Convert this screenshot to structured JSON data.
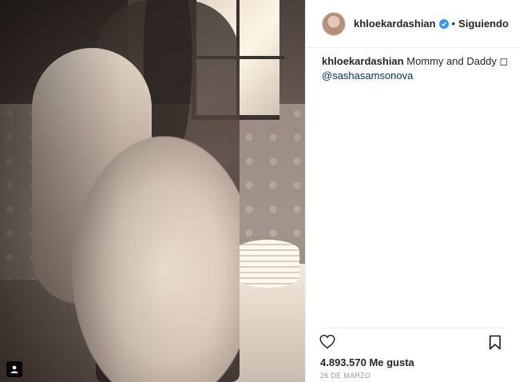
{
  "header": {
    "username": "khloekardashian",
    "separator": "•",
    "follow_status": "Siguiendo"
  },
  "caption": {
    "username": "khloekardashian",
    "text": "Mommy and Daddy ◻",
    "mention": "@sashasamsonova"
  },
  "stats": {
    "likes": "4.893.570 Me gusta",
    "date": "26 DE MARZO"
  },
  "icons": {
    "verified": "verified-badge-icon",
    "like": "heart-icon",
    "save": "bookmark-icon",
    "tag": "user-tag-icon"
  },
  "colors": {
    "verified": "#3897f0",
    "mention": "#003569",
    "date": "#999999"
  }
}
